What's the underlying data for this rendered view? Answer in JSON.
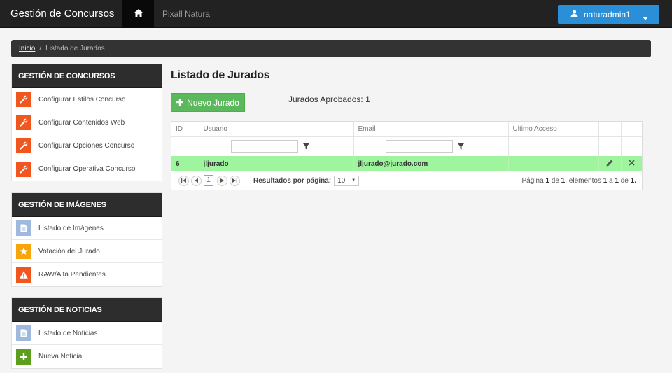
{
  "navbar": {
    "brand": "Gestión de Concursos",
    "home_icon": "home-icon",
    "link": "Pixall Natura",
    "user": "naturadmin1",
    "user_icon": "user-icon"
  },
  "breadcrumb": {
    "home": "Inicio",
    "separator": "/",
    "current": "Listado de Jurados"
  },
  "sidebar": {
    "concursos": {
      "title": "GESTIÓN DE CONCURSOS",
      "items": [
        {
          "label": "Configurar Estilos Concurso",
          "icon": "wrench-icon"
        },
        {
          "label": "Configurar Contenidos Web",
          "icon": "wrench-icon"
        },
        {
          "label": "Configurar Opciones Concurso",
          "icon": "wrench-icon"
        },
        {
          "label": "Configurar Operativa Concurso",
          "icon": "wrench-icon"
        }
      ]
    },
    "imagenes": {
      "title": "GESTIÓN DE IMÁGENES",
      "items": [
        {
          "label": "Listado de Imágenes",
          "icon": "document-icon"
        },
        {
          "label": "Votación del Jurado",
          "icon": "star-icon"
        },
        {
          "label": "RAW/Alta Pendientes",
          "icon": "warning-icon"
        }
      ]
    },
    "noticias": {
      "title": "GESTIÓN DE NOTICIAS",
      "items": [
        {
          "label": "Listado de Noticias",
          "icon": "document-icon"
        },
        {
          "label": "Nueva Noticia",
          "icon": "plus-icon"
        }
      ]
    }
  },
  "main": {
    "title": "Listado de Jurados",
    "new_button": "Nuevo Jurado",
    "approved": "Jurados Aprobados: 1"
  },
  "grid": {
    "columns": [
      "ID",
      "Usuario",
      "Email",
      "Ultimo Acceso",
      "",
      ""
    ],
    "filters": {
      "usuario": "",
      "email": ""
    },
    "rows": [
      {
        "id": "6",
        "usuario": "jljurado",
        "email": "jljurado@jurado.com",
        "ultimo_acceso": ""
      }
    ],
    "pager": {
      "current_page": "1",
      "per_page_label": "Resultados por página:",
      "per_page": "10",
      "info_pagina": "Página",
      "page": "1",
      "info_de": "de",
      "total_pages": "1",
      "info_elementos": ", elementos",
      "from": "1",
      "info_a": "a",
      "to": "1",
      "info_de2": "de",
      "total": "1",
      "info_end": "."
    }
  },
  "colors": {
    "navbar": "#222222",
    "accent_blue": "#2a8fd6",
    "success_green": "#5cb85c",
    "row_highlight": "#9ef59e",
    "icon_orange": "#f0561d"
  }
}
